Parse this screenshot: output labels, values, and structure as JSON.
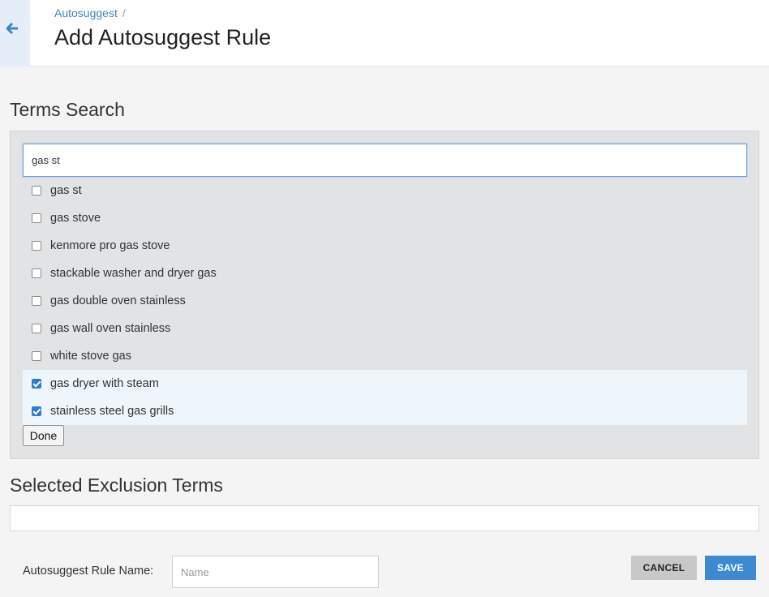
{
  "header": {
    "breadcrumb_link": "Autosuggest",
    "breadcrumb_sep": "/",
    "title": "Add Autosuggest Rule"
  },
  "terms_search": {
    "title": "Terms Search",
    "query": "gas st",
    "items": [
      {
        "label": "gas st",
        "checked": false
      },
      {
        "label": "gas stove",
        "checked": false
      },
      {
        "label": "kenmore pro gas stove",
        "checked": false
      },
      {
        "label": "stackable washer and dryer gas",
        "checked": false
      },
      {
        "label": "gas double oven stainless",
        "checked": false
      },
      {
        "label": "gas wall oven stainless",
        "checked": false
      },
      {
        "label": "white stove gas",
        "checked": false
      },
      {
        "label": "gas dryer with steam",
        "checked": true
      },
      {
        "label": "stainless steel gas grills",
        "checked": true
      }
    ],
    "done_label": "Done"
  },
  "exclusion": {
    "title": "Selected Exclusion Terms"
  },
  "rule": {
    "name_label": "Autosuggest Rule Name:",
    "name_placeholder": "Name",
    "cancel_label": "CANCEL",
    "save_label": "SAVE"
  },
  "colors": {
    "accent": "#3d8ad2",
    "link": "#3d85c6",
    "selected_row": "#eef5fb"
  },
  "icons": {
    "back": "arrow-left-icon"
  }
}
